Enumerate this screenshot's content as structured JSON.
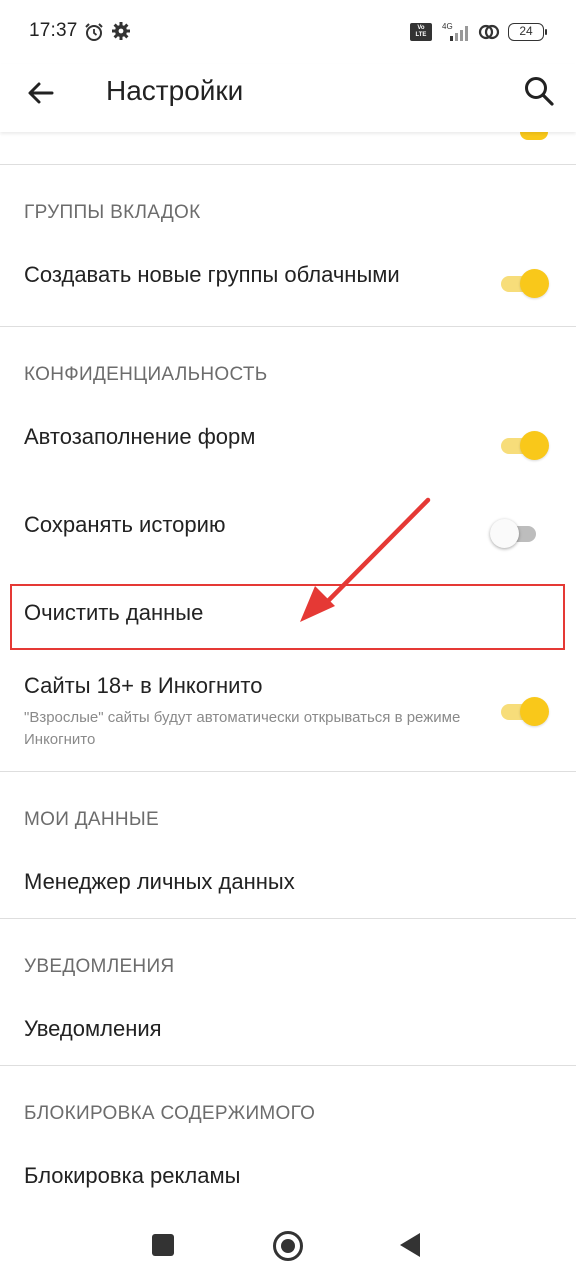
{
  "status_bar": {
    "time": "17:37",
    "network": "4G",
    "battery": "24",
    "icons": [
      "alarm-icon",
      "gear-icon",
      "volte-icon",
      "signal-icon",
      "hotspot-icon",
      "battery-icon"
    ]
  },
  "app_bar": {
    "title": "Настройки",
    "back_icon": "arrow-left-icon",
    "search_icon": "search-icon"
  },
  "sections": {
    "tab_groups": {
      "header": "ГРУППЫ ВКЛАДОК",
      "items": [
        {
          "label": "Создавать новые группы облачными",
          "toggle": "on"
        }
      ]
    },
    "privacy": {
      "header": "КОНФИДЕНЦИАЛЬНОСТЬ",
      "items": [
        {
          "label": "Автозаполнение форм",
          "toggle": "on"
        },
        {
          "label": "Сохранять историю",
          "toggle": "off"
        },
        {
          "label": "Очистить данные"
        },
        {
          "label": "Сайты 18+ в Инкогнито",
          "sub": "\"Взрослые\" сайты будут автоматически открываться в режиме Инкогнито",
          "toggle": "on"
        }
      ]
    },
    "my_data": {
      "header": "МОИ ДАННЫЕ",
      "items": [
        {
          "label": "Менеджер личных данных"
        }
      ]
    },
    "notifications": {
      "header": "УВЕДОМЛЕНИЯ",
      "items": [
        {
          "label": "Уведомления"
        }
      ]
    },
    "content_blocking": {
      "header": "БЛОКИРОВКА СОДЕРЖИМОГО",
      "items": [
        {
          "label": "Блокировка рекламы"
        }
      ]
    }
  },
  "colors": {
    "accent": "#f9c81a",
    "annotation": "#e53935"
  }
}
